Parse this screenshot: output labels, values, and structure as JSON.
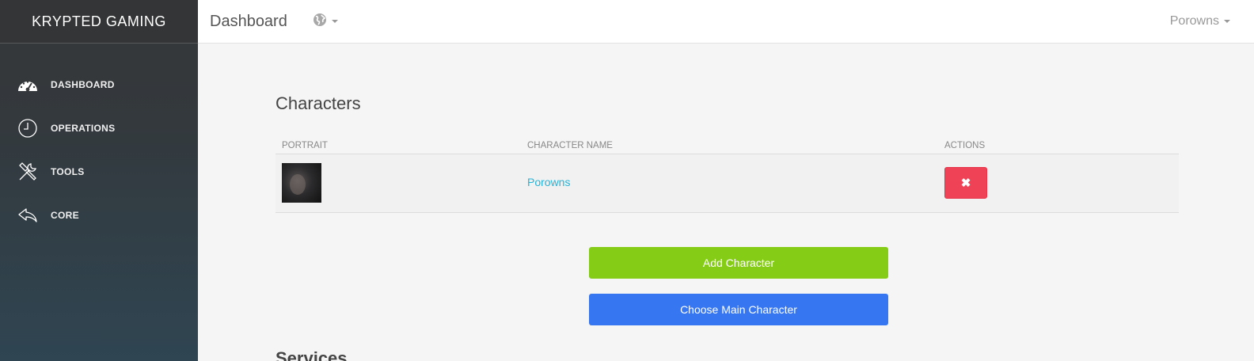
{
  "sidebar": {
    "brand": "KRYPTED GAMING",
    "items": [
      {
        "label": "DASHBOARD",
        "icon": "dashboard-icon"
      },
      {
        "label": "OPERATIONS",
        "icon": "clock-icon"
      },
      {
        "label": "TOOLS",
        "icon": "tools-icon"
      },
      {
        "label": "CORE",
        "icon": "reply-arrow-icon"
      }
    ]
  },
  "header": {
    "title": "Dashboard",
    "language_icon": "globe-icon",
    "user": "Porowns"
  },
  "characters": {
    "title": "Characters",
    "columns": [
      "PORTRAIT",
      "CHARACTER NAME",
      "ACTIONS"
    ],
    "rows": [
      {
        "name": "Porowns",
        "delete_label": "✖"
      }
    ],
    "add_button": "Add Character",
    "main_button": "Choose Main Character"
  },
  "services": {
    "title": "Services"
  },
  "colors": {
    "accent_link": "#27b3d6",
    "danger": "#f04256",
    "success": "#85cc17",
    "primary": "#3676f1"
  }
}
